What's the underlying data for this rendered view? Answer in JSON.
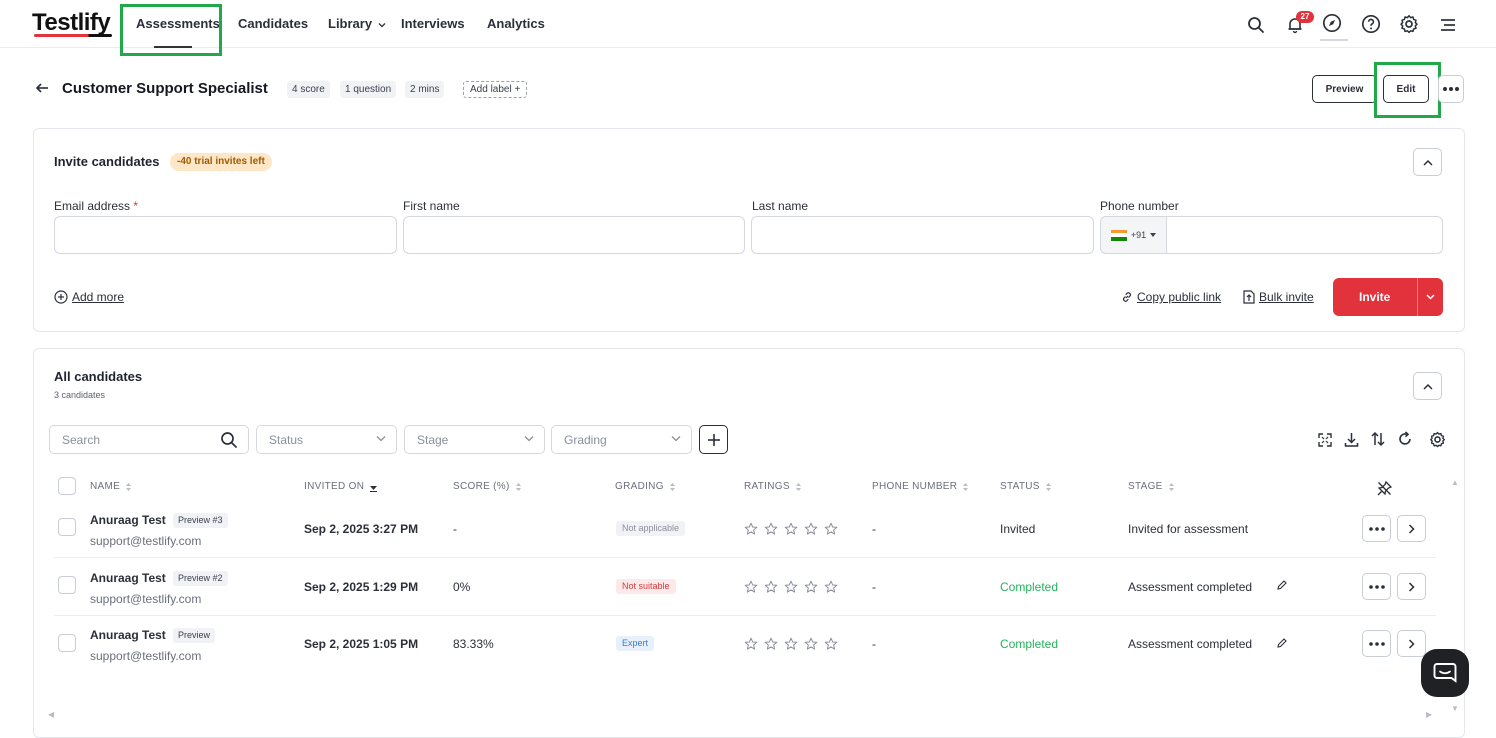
{
  "nav": {
    "logo": "Testlify",
    "items": [
      "Assessments",
      "Candidates",
      "Library",
      "Interviews",
      "Analytics"
    ],
    "notifications_count": "27"
  },
  "assessment": {
    "title": "Customer Support Specialist",
    "chips": [
      "4 score",
      "1 question",
      "2 mins"
    ],
    "add_label": "Add label +",
    "preview_label": "Preview",
    "edit_label": "Edit"
  },
  "invite": {
    "title": "Invite candidates",
    "trial_badge": "-40 trial invites left",
    "fields": {
      "email_label": "Email address",
      "email_required_mark": "*",
      "first_name_label": "First name",
      "last_name_label": "Last name",
      "phone_label": "Phone number",
      "phone_code": "+91"
    },
    "add_more": "Add more",
    "copy_public_link": "Copy public link",
    "bulk_invite": "Bulk invite",
    "invite_button": "Invite"
  },
  "candidates": {
    "title": "All candidates",
    "count": "3 candidates",
    "search_placeholder": "Search",
    "filters": [
      "Status",
      "Stage",
      "Grading"
    ],
    "columns": [
      "NAME",
      "INVITED ON",
      "SCORE (%)",
      "GRADING",
      "RATINGS",
      "PHONE NUMBER",
      "STATUS",
      "STAGE"
    ],
    "rows": [
      {
        "name": "Anuraag Test",
        "tag": "Preview #3",
        "email": "support@testlify.com",
        "invited_on": "Sep 2, 2025 3:27 PM",
        "score": "-",
        "grading": "Not applicable",
        "phone": "-",
        "status": "Invited",
        "stage": "Invited for assessment"
      },
      {
        "name": "Anuraag Test",
        "tag": "Preview #2",
        "email": "support@testlify.com",
        "invited_on": "Sep 2, 2025 1:29 PM",
        "score": "0%",
        "grading": "Not suitable",
        "phone": "-",
        "status": "Completed",
        "stage": "Assessment completed"
      },
      {
        "name": "Anuraag Test",
        "tag": "Preview",
        "email": "support@testlify.com",
        "invited_on": "Sep 2, 2025 1:05 PM",
        "score": "83.33%",
        "grading": "Expert",
        "phone": "-",
        "status": "Completed",
        "stage": "Assessment completed"
      }
    ]
  },
  "colors": {
    "brand_red": "#e2323b",
    "highlight_green": "#22a84a",
    "completed_green": "#22b45a",
    "not_suitable_red": "#d43c3c",
    "expert_blue": "#3a7bd5"
  },
  "icons": [
    "search-icon",
    "bell-icon",
    "compass-icon",
    "help-icon",
    "gear-icon",
    "menu-icon",
    "back-arrow-icon",
    "chevron-up-icon",
    "chevron-down-icon",
    "plus-circle-icon",
    "link-icon",
    "upload-icon",
    "expand-icon",
    "download-icon",
    "sort-icon",
    "refresh-icon",
    "unpin-icon",
    "star-icon",
    "more-icon",
    "chevron-right-icon",
    "chat-icon"
  ]
}
